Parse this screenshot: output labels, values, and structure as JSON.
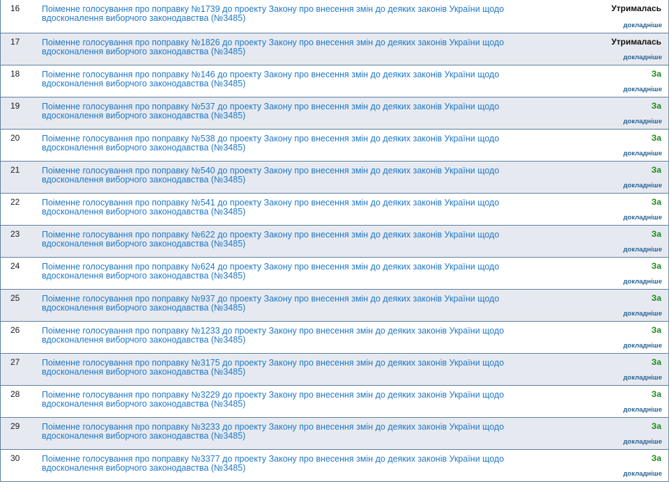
{
  "colors": {
    "link": "#1f78c8",
    "za": "#1a8a1a",
    "abstain": "#111111",
    "more_link": "#2a6496",
    "row_alt_bg": "#e6eaf0",
    "border": "#5d7f9f"
  },
  "more_label": "докладніше",
  "rows": [
    {
      "num": "16",
      "line1": "Поіменне голосування про поправку №1739 до проекту Закону про внесення змін до деяких законів України щодо",
      "line2": "вдосконалення виборчого законодавства (№3485)",
      "result": "Утрималась",
      "result_type": "abstain"
    },
    {
      "num": "17",
      "line1": "Поіменне голосування про поправку №1826 до проекту Закону про внесення змін до деяких законів України щодо",
      "line2": "вдосконалення виборчого законодавства (№3485)",
      "result": "Утрималась",
      "result_type": "abstain"
    },
    {
      "num": "18",
      "line1": "Поіменне голосування про поправку №146 до проекту Закону про внесення змін до деяких законів України щодо",
      "line2": "вдосконалення виборчого законодавства (№3485)",
      "result": "За",
      "result_type": "za"
    },
    {
      "num": "19",
      "line1": "Поіменне голосування про поправку №537 до проекту Закону про внесення змін до деяких законів України щодо",
      "line2": "вдосконалення виборчого законодавства (№3485)",
      "result": "За",
      "result_type": "za"
    },
    {
      "num": "20",
      "line1": "Поіменне голосування про поправку №538 до проекту Закону про внесення змін до деяких законів України щодо",
      "line2": "вдосконалення виборчого законодавства (№3485)",
      "result": "За",
      "result_type": "za"
    },
    {
      "num": "21",
      "line1": "Поіменне голосування про поправку №540 до проекту Закону про внесення змін до деяких законів України щодо",
      "line2": "вдосконалення виборчого законодавства (№3485)",
      "result": "За",
      "result_type": "za"
    },
    {
      "num": "22",
      "line1": "Поіменне голосування про поправку №541 до проекту Закону про внесення змін до деяких законів України щодо",
      "line2": "вдосконалення виборчого законодавства (№3485)",
      "result": "За",
      "result_type": "za"
    },
    {
      "num": "23",
      "line1": "Поіменне голосування про поправку №622 до проекту Закону про внесення змін до деяких законів України щодо",
      "line2": "вдосконалення виборчого законодавства (№3485)",
      "result": "За",
      "result_type": "za"
    },
    {
      "num": "24",
      "line1": "Поіменне голосування про поправку №624 до проекту Закону про внесення змін до деяких законів України щодо",
      "line2": "вдосконалення виборчого законодавства (№3485)",
      "result": "За",
      "result_type": "za"
    },
    {
      "num": "25",
      "line1": "Поіменне голосування про поправку №937 до проекту Закону про внесення змін до деяких законів України щодо",
      "line2": "вдосконалення виборчого законодавства (№3485)",
      "result": "За",
      "result_type": "za"
    },
    {
      "num": "26",
      "line1": "Поіменне голосування про поправку №1233 до проекту Закону про внесення змін до деяких законів України щодо",
      "line2": "вдосконалення виборчого законодавства (№3485)",
      "result": "За",
      "result_type": "za"
    },
    {
      "num": "27",
      "line1": "Поіменне голосування про поправку №3175 до проекту Закону про внесення змін до деяких законів України щодо",
      "line2": "вдосконалення виборчого законодавства (№3485)",
      "result": "За",
      "result_type": "za"
    },
    {
      "num": "28",
      "line1": "Поіменне голосування про поправку №3229 до проекту Закону про внесення змін до деяких законів України щодо",
      "line2": "вдосконалення виборчого законодавства (№3485)",
      "result": "За",
      "result_type": "za"
    },
    {
      "num": "29",
      "line1": "Поіменне голосування про поправку №3233 до проекту Закону про внесення змін до деяких законів України щодо",
      "line2": "вдосконалення виборчого законодавства (№3485)",
      "result": "За",
      "result_type": "za"
    },
    {
      "num": "30",
      "line1": "Поіменне голосування про поправку №3377 до проекту Закону про внесення змін до деяких законів України щодо",
      "line2": "вдосконалення виборчого законодавства (№3485)",
      "result": "За",
      "result_type": "za"
    }
  ]
}
